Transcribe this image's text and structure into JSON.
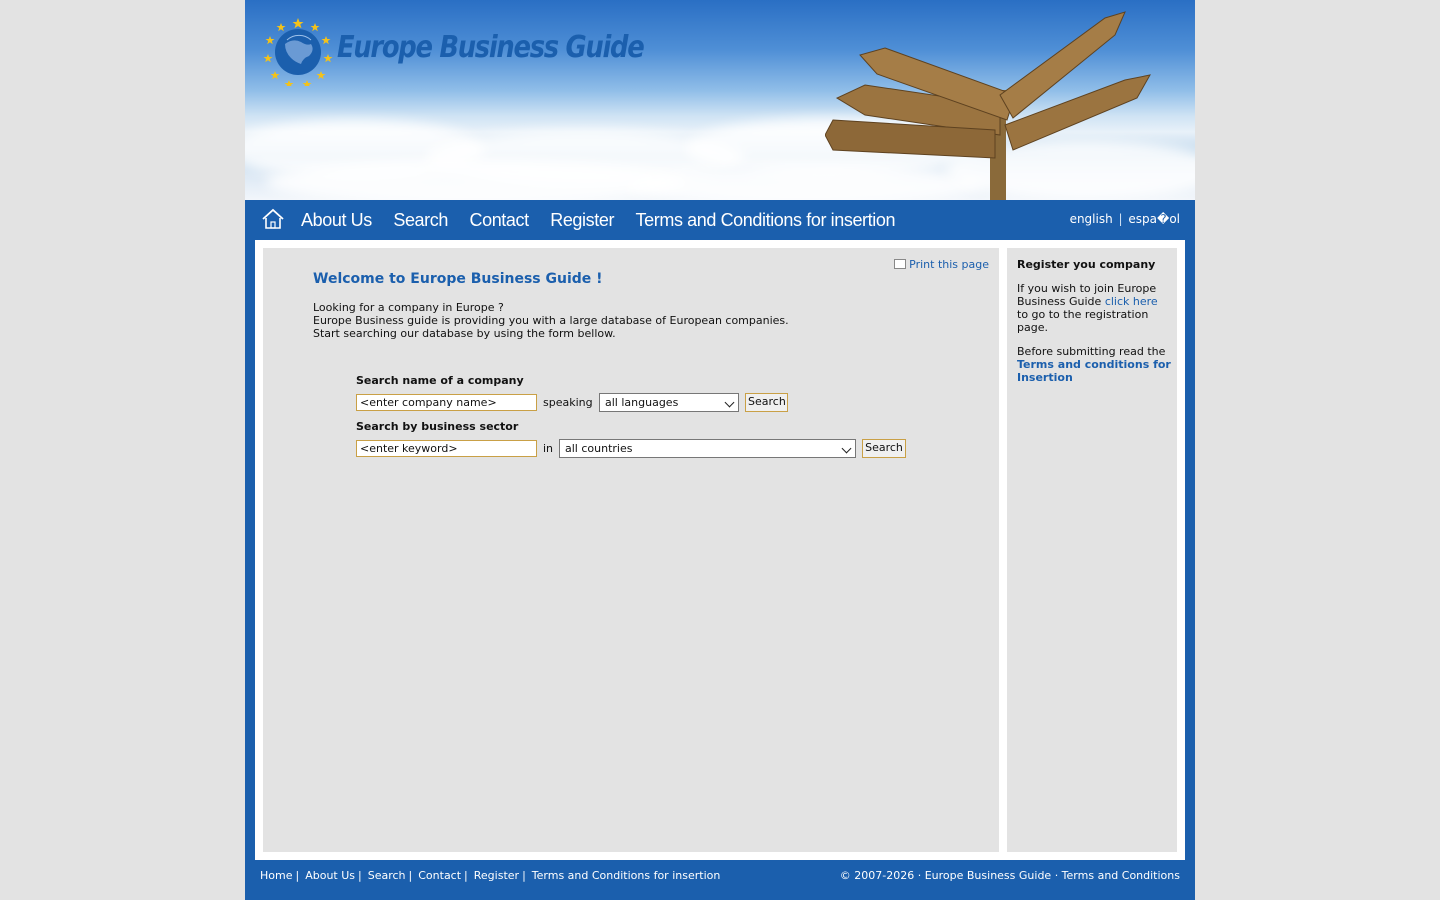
{
  "header": {
    "logo_text": "Europe Business Guide"
  },
  "nav": {
    "items": [
      {
        "label": "About Us"
      },
      {
        "label": "Search"
      },
      {
        "label": "Contact"
      },
      {
        "label": "Register"
      },
      {
        "label": "Terms and Conditions for insertion"
      }
    ],
    "lang": {
      "english": "english",
      "sep": "|",
      "espanol": "espa�ol"
    }
  },
  "main": {
    "print_label": "Print this page",
    "welcome": "Welcome to Europe Business Guide !",
    "intro": [
      "Looking for a company in Europe ?",
      "Europe Business guide is providing you with a large database of European companies.",
      "Start searching our database by using the form bellow."
    ],
    "search_company": {
      "label": "Search name of a company",
      "input_value": "<enter company name>",
      "speaking_label": "speaking",
      "select_value": "all languages",
      "button": "Search"
    },
    "search_sector": {
      "label": "Search by business sector",
      "input_value": "<enter keyword>",
      "in_label": "in",
      "select_value": "all countries",
      "button": "Search"
    }
  },
  "sidebar": {
    "title": "Register you company",
    "p1_pre": "If you wish to join Europe Business Guide ",
    "p1_link": "click here",
    "p1_post": " to go to the registration page.",
    "p2_pre": "Before submitting read the ",
    "p2_link": "Terms and conditions for Insertion"
  },
  "footer": {
    "links": [
      "Home",
      "About Us",
      "Search",
      "Contact",
      "Register",
      "Terms and Conditions for insertion"
    ],
    "separator": "|",
    "copyright": "© 2007-2026 · Europe Business Guide · Terms and Conditions"
  },
  "colors": {
    "brand_blue": "#1b5fad",
    "input_border": "#c9a046",
    "panel_gray": "#e3e3e3"
  }
}
